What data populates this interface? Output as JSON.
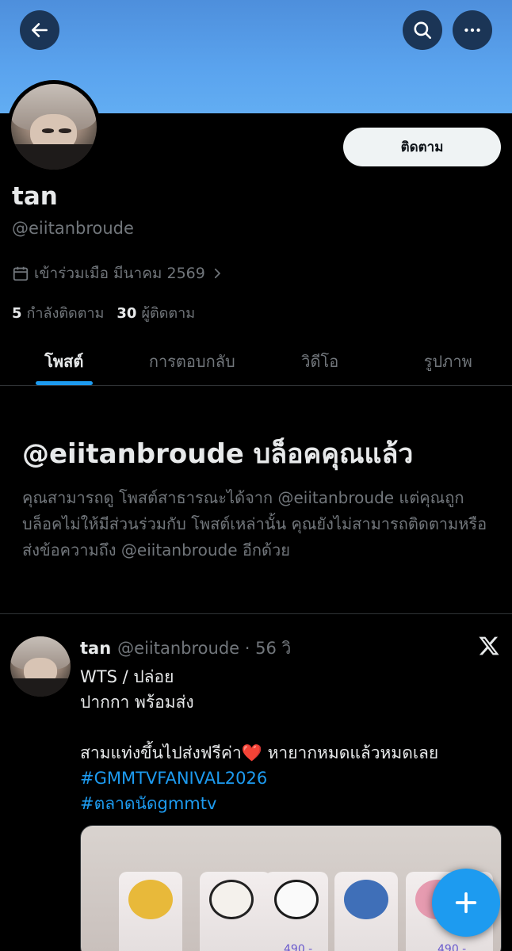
{
  "profile": {
    "display_name": "tan",
    "handle": "@eiitanbroude",
    "joined": "เข้าร่วมเมือ มีนาคม 2569",
    "following_count": "5",
    "following_label": "กำลังติดตาม",
    "followers_count": "30",
    "followers_label": "ผู้ติดตาม",
    "follow_button": "ติดตาม"
  },
  "tabs": [
    {
      "label": "โพสต์",
      "active": true
    },
    {
      "label": "การตอบกลับ",
      "active": false
    },
    {
      "label": "วิดีโอ",
      "active": false
    },
    {
      "label": "รูปภาพ",
      "active": false
    }
  ],
  "blocked": {
    "title": "@eiitanbroude บล็อคคุณแล้ว",
    "description": "คุณสามารถดู โพสต์สาธารณะได้จาก @eiitanbroude แต่คุณถูกบล็อคไม่ให้มีส่วนร่วมกับ โพสต์เหล่านั้น คุณยังไม่สามารถติดตามหรือส่งข้อความถึง @eiitanbroude อีกด้วย"
  },
  "post": {
    "name": "tan",
    "meta": "@eiitanbroude · 56 วิ",
    "line1": "WTS  / ปล่อย",
    "line2": "ปากกา พร้อมส่ง",
    "line3_text": "สามแท่งขึ้นไปส่งฟรีค่า",
    "line3_emoji": "❤️",
    "line3_tail": " หายากหมดแล้วหมดเลย",
    "hashtag1": "#GMMTVFANIVAL2026",
    "hashtag2": "#ตลาดนัดgmmtv",
    "prices": [
      "490.-",
      "490.-"
    ]
  },
  "icons": {
    "back": "arrow-left-icon",
    "search": "search-icon",
    "more": "more-horizontal-icon",
    "calendar": "calendar-icon",
    "chevron": "chevron-right-icon",
    "x_logo": "x-logo-icon",
    "compose": "plus-icon"
  },
  "colors": {
    "accent": "#1d9bf0",
    "background": "#000000",
    "muted": "#71767b",
    "banner": "#5aa3ee"
  }
}
